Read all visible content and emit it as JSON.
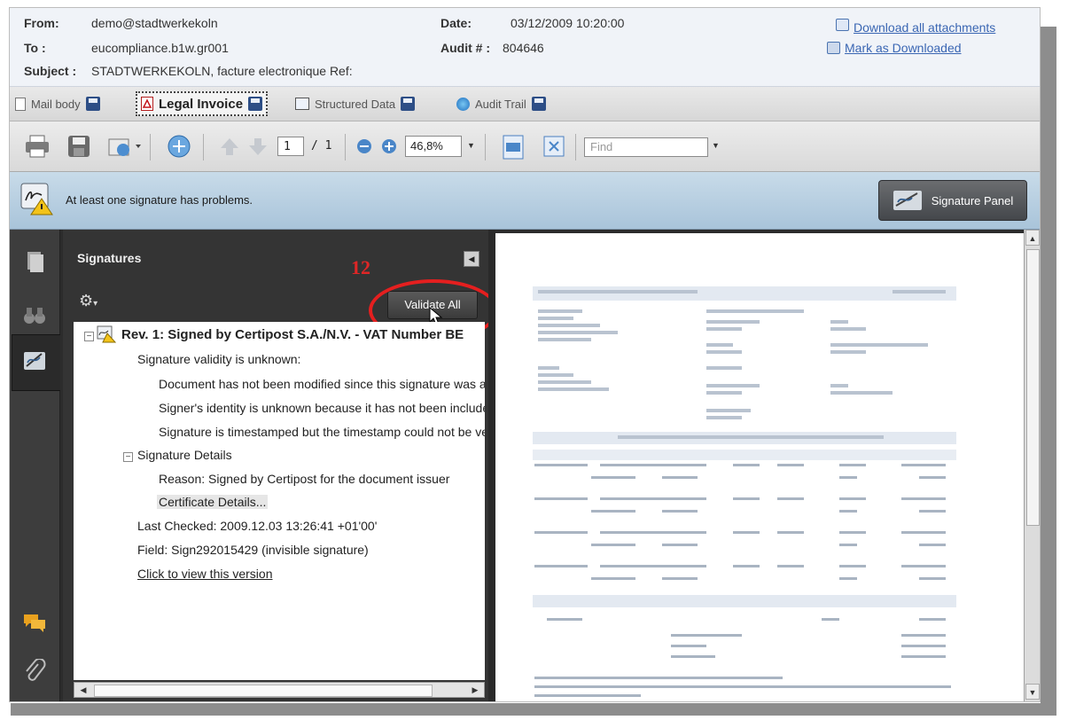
{
  "header": {
    "from_label": "From:",
    "from_value": "demo@stadtwerkekoln",
    "to_label": "To :",
    "to_value": "eucompliance.b1w.gr001",
    "subject_label": "Subject :",
    "subject_value": "STADTWERKEKOLN, facture electronique Ref:",
    "date_label": "Date:",
    "date_value": "03/12/2009 10:20:00",
    "audit_label": "Audit # :",
    "audit_value": "804646",
    "download_all": "Download all attachments",
    "mark_downloaded": "Mark as Downloaded"
  },
  "tabs": [
    {
      "label": "Mail body"
    },
    {
      "label": "Legal Invoice"
    },
    {
      "label": "Structured Data"
    },
    {
      "label": "Audit Trail"
    }
  ],
  "toolbar": {
    "page_current": "1",
    "page_total": "/ 1",
    "zoom": "46,8%",
    "find_placeholder": "Find"
  },
  "message_bar": {
    "text": "At least one signature has problems.",
    "signature_panel": "Signature Panel"
  },
  "signatures": {
    "title": "Signatures",
    "validate_all": "Validate All",
    "annotation": "12",
    "tree": [
      "Rev. 1: Signed by Certipost S.A./N.V. - VAT Number BE",
      "Signature validity is unknown:",
      "Document has not been modified since this signature was applied",
      "Signer's identity is unknown because it has not been included",
      "Signature is timestamped but the timestamp could not be verified",
      "Signature Details",
      "Reason: Signed by Certipost for the document issuer",
      "Certificate Details...",
      "Last Checked: 2009.12.03 13:26:41 +01'00'",
      "Field: Sign292015429 (invisible signature)",
      "Click to view this version"
    ]
  },
  "colors": {
    "link": "#3a66b3",
    "annotation": "#e51f1f",
    "message_bar": "#b7cfe1",
    "panel_dark": "#343434"
  }
}
